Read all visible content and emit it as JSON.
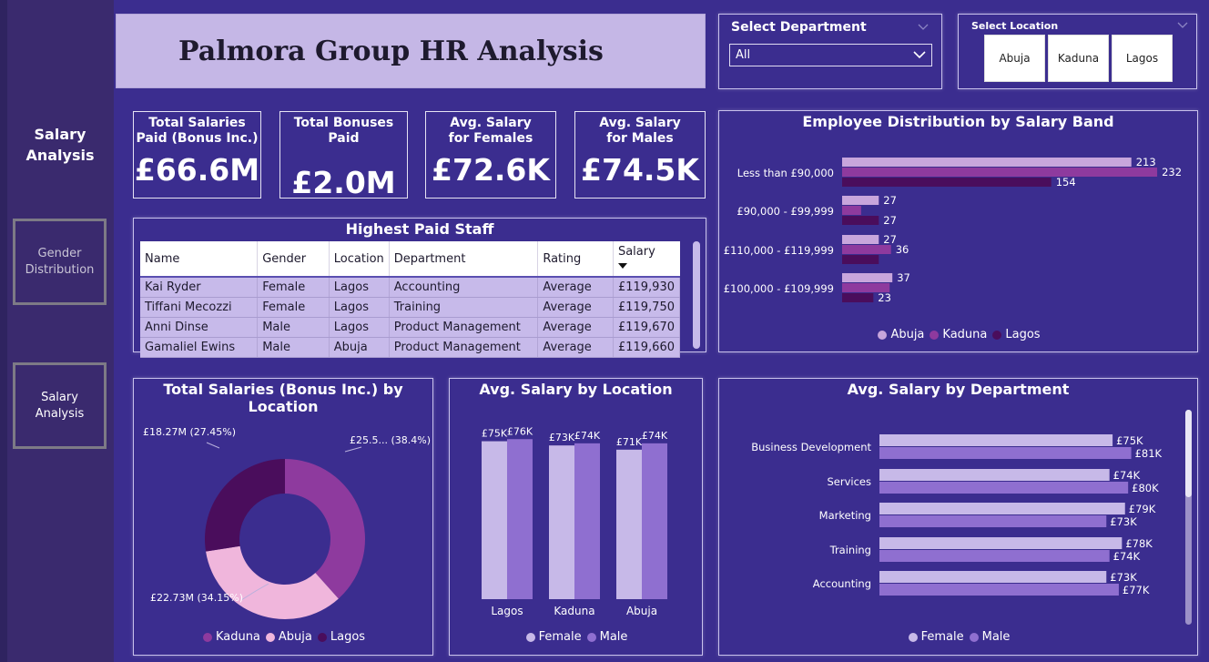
{
  "sidebar": {
    "title": "Salary Analysis",
    "buttons": [
      {
        "label": "Gender Distribution"
      },
      {
        "label": "Salary Analysis"
      }
    ]
  },
  "header": {
    "title": "Palmora Group HR Analysis"
  },
  "department_slicer": {
    "label": "Select Department",
    "value": "All"
  },
  "location_slicer": {
    "label": "Select Location",
    "options": [
      "Abuja",
      "Kaduna",
      "Lagos"
    ]
  },
  "kpis": [
    {
      "label": "Total Salaries Paid (Bonus Inc.)",
      "value": "£66.6M"
    },
    {
      "label": "Total Bonuses Paid",
      "value": "£2.0M"
    },
    {
      "label": "Avg. Salary for Females",
      "value": "£72.6K"
    },
    {
      "label": "Avg. Salary for Males",
      "value": "£74.5K"
    }
  ],
  "staff_table": {
    "title": "Highest Paid Staff",
    "columns": [
      "Name",
      "Gender",
      "Location",
      "Department",
      "Rating",
      "Salary"
    ],
    "rows": [
      [
        "Kai Ryder",
        "Female",
        "Lagos",
        "Accounting",
        "Average",
        "£119,930"
      ],
      [
        "Tiffani Mecozzi",
        "Female",
        "Lagos",
        "Training",
        "Average",
        "£119,750"
      ],
      [
        "Anni Dinse",
        "Male",
        "Lagos",
        "Product Management",
        "Average",
        "£119,670"
      ],
      [
        "Gamaliel Ewins",
        "Male",
        "Abuja",
        "Product Management",
        "Average",
        "£119,660"
      ]
    ]
  },
  "colors": {
    "abuja": "#c8a6dc",
    "kaduna": "#8e3a9e",
    "lagos": "#4a0d5c",
    "female": "#c7b9e8",
    "male": "#8f6fd0",
    "pie_abuja": "#f0b6dc",
    "background": "#3b2d8f"
  },
  "chart_data": [
    {
      "type": "bar",
      "orientation": "horizontal",
      "title": "Employee Distribution by Salary Band",
      "categories": [
        "Less than £90,000",
        "£90,000 - £99,999",
        "£110,000 - £119,999",
        "£100,000 - £109,999"
      ],
      "series": [
        {
          "name": "Abuja",
          "values": [
            213,
            27,
            27,
            37
          ],
          "labels": [
            "213",
            "27",
            "27",
            "37"
          ]
        },
        {
          "name": "Kaduna",
          "values": [
            232,
            14,
            36,
            35
          ],
          "labels": [
            "232",
            "",
            "36",
            ""
          ]
        },
        {
          "name": "Lagos",
          "values": [
            154,
            27,
            27,
            23
          ],
          "labels": [
            "154",
            "27",
            "",
            "23"
          ]
        }
      ],
      "xlim": [
        0,
        240
      ],
      "legend": "bottom"
    },
    {
      "type": "pie",
      "title": "Total Salaries (Bonus Inc.) by Location",
      "categories": [
        "Kaduna",
        "Abuja",
        "Lagos"
      ],
      "values": [
        25.5,
        22.73,
        18.27
      ],
      "labels": [
        "£25.5... (38.4%)",
        "£22.73M (34.15%)",
        "£18.27M (27.45%)"
      ],
      "legend": "bottom"
    },
    {
      "type": "bar",
      "title": "Avg. Salary by Location",
      "categories": [
        "Lagos",
        "Kaduna",
        "Abuja"
      ],
      "series": [
        {
          "name": "Female",
          "values": [
            75,
            73,
            71
          ],
          "labels": [
            "£75K",
            "£73K",
            "£71K"
          ]
        },
        {
          "name": "Male",
          "values": [
            76,
            74,
            74
          ],
          "labels": [
            "£76K",
            "£74K",
            "£74K"
          ]
        }
      ],
      "ylim": [
        0,
        80
      ],
      "legend": "bottom"
    },
    {
      "type": "bar",
      "orientation": "horizontal",
      "title": "Avg. Salary by Department",
      "categories": [
        "Business Development",
        "Services",
        "Marketing",
        "Training",
        "Accounting"
      ],
      "series": [
        {
          "name": "Female",
          "values": [
            75,
            74,
            79,
            78,
            73
          ],
          "labels": [
            "£75K",
            "£74K",
            "£79K",
            "£78K",
            "£73K"
          ]
        },
        {
          "name": "Male",
          "values": [
            81,
            80,
            73,
            74,
            77
          ],
          "labels": [
            "£81K",
            "£80K",
            "£73K",
            "£74K",
            "£77K"
          ]
        }
      ],
      "xlim": [
        0,
        82
      ],
      "legend": "bottom"
    }
  ]
}
